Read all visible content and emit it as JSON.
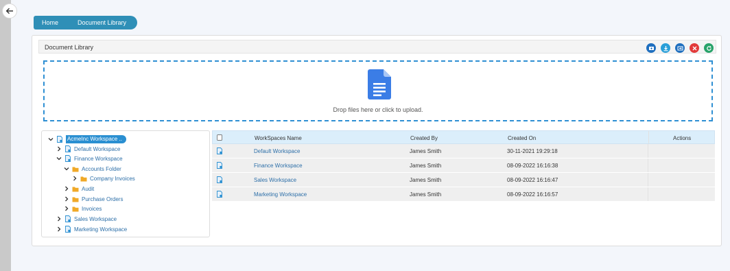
{
  "breadcrumb": {
    "home": "Home",
    "current": "Document Library"
  },
  "panel": {
    "title": "Document Library",
    "toolbar": [
      {
        "name": "new-folder",
        "color": "#1f6fbf"
      },
      {
        "name": "download",
        "color": "#2a9fd8"
      },
      {
        "name": "move",
        "color": "#1f6fbf"
      },
      {
        "name": "delete",
        "color": "#e23a3a"
      },
      {
        "name": "refresh",
        "color": "#29a36a"
      }
    ]
  },
  "dropzone": {
    "text": "Drop files here or click to upload."
  },
  "tree": {
    "root": "AcmeInc Workspace ..",
    "items": [
      {
        "label": "Default Workspace"
      },
      {
        "label": "Finance Workspace"
      },
      {
        "label": "Accounts Folder"
      },
      {
        "label": "Company Invoices"
      },
      {
        "label": "Audit"
      },
      {
        "label": "Purchase Orders"
      },
      {
        "label": "Invoices"
      },
      {
        "label": "Sales Workspace"
      },
      {
        "label": "Marketing Workspace"
      }
    ]
  },
  "grid": {
    "columns": {
      "name": "WorkSpaces Name",
      "created_by": "Created By",
      "created_on": "Created On",
      "actions": "Actions"
    },
    "rows": [
      {
        "name": "Default Workspace",
        "created_by": "James Smith",
        "created_on": "30-11-2021 19:29:18"
      },
      {
        "name": "Finance Workspace",
        "created_by": "James Smith",
        "created_on": "08-09-2022 16:16:38"
      },
      {
        "name": "Sales Workspace",
        "created_by": "James Smith",
        "created_on": "08-09-2022 16:16:47"
      },
      {
        "name": "Marketing Workspace",
        "created_by": "James Smith",
        "created_on": "08-09-2022 16:16:57"
      }
    ]
  }
}
